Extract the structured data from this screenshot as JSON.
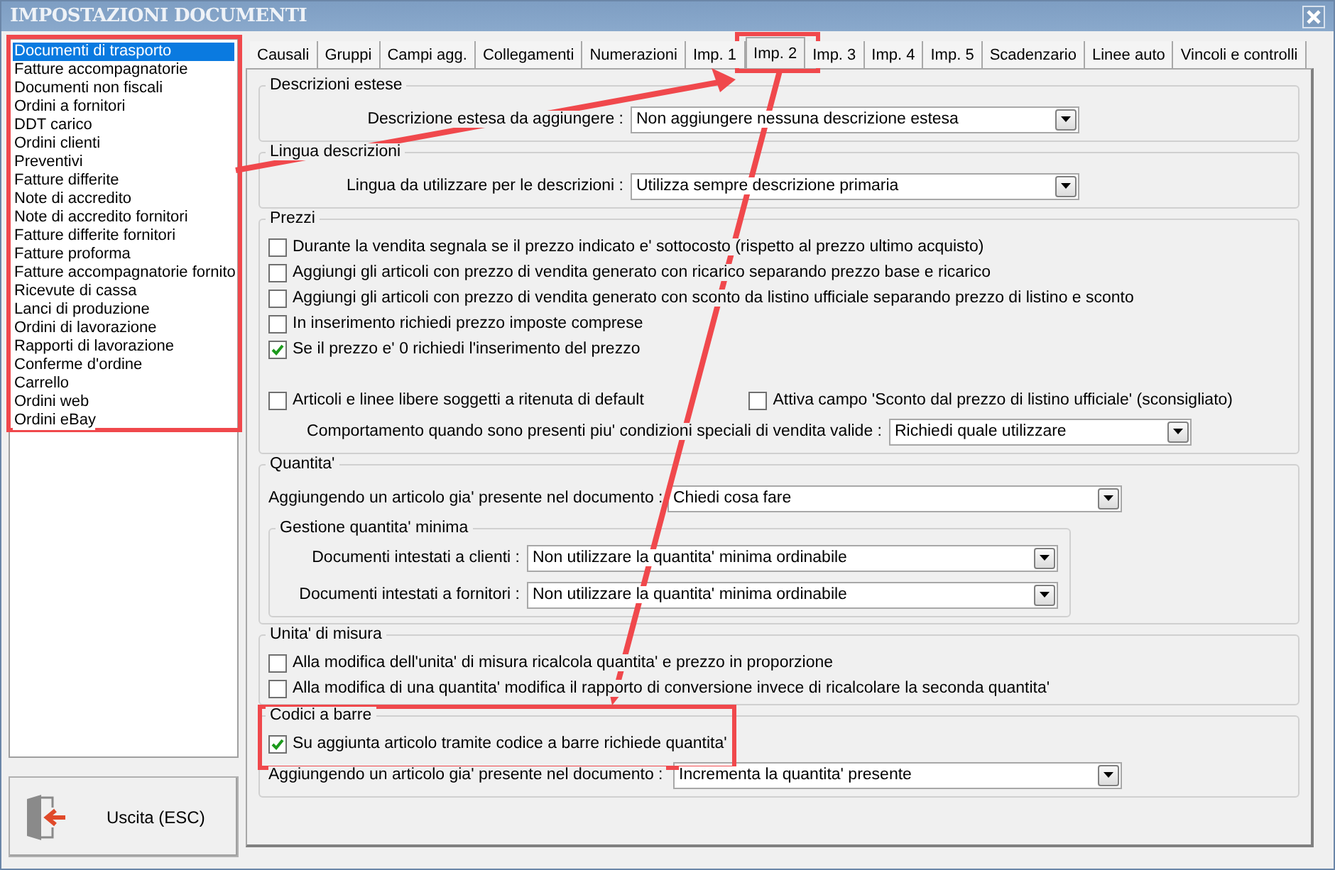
{
  "window": {
    "title": "IMPOSTAZIONI DOCUMENTI"
  },
  "document_types": [
    {
      "label": "Documenti di trasporto",
      "selected": true
    },
    {
      "label": "Fatture accompagnatorie",
      "selected": false
    },
    {
      "label": "Documenti non fiscali",
      "selected": false
    },
    {
      "label": "Ordini a fornitori",
      "selected": false
    },
    {
      "label": "DDT carico",
      "selected": false
    },
    {
      "label": "Ordini clienti",
      "selected": false
    },
    {
      "label": "Preventivi",
      "selected": false
    },
    {
      "label": "Fatture differite",
      "selected": false
    },
    {
      "label": "Note di accredito",
      "selected": false
    },
    {
      "label": "Note di accredito fornitori",
      "selected": false
    },
    {
      "label": "Fatture differite fornitori",
      "selected": false
    },
    {
      "label": "Fatture proforma",
      "selected": false
    },
    {
      "label": "Fatture accompagnatorie fornito",
      "selected": false
    },
    {
      "label": "Ricevute di cassa",
      "selected": false
    },
    {
      "label": "Lanci di produzione",
      "selected": false
    },
    {
      "label": "Ordini di lavorazione",
      "selected": false
    },
    {
      "label": "Rapporti di lavorazione",
      "selected": false
    },
    {
      "label": "Conferme d'ordine",
      "selected": false
    },
    {
      "label": "Carrello",
      "selected": false
    },
    {
      "label": "Ordini web",
      "selected": false
    },
    {
      "label": "Ordini eBay",
      "selected": false
    }
  ],
  "exit_button": {
    "label": "Uscita (ESC)"
  },
  "tabs": [
    {
      "label": "Causali",
      "selected": false
    },
    {
      "label": "Gruppi",
      "selected": false
    },
    {
      "label": "Campi agg.",
      "selected": false
    },
    {
      "label": "Collegamenti",
      "selected": false
    },
    {
      "label": "Numerazioni",
      "selected": false
    },
    {
      "label": "Imp. 1",
      "selected": false
    },
    {
      "label": "Imp. 2",
      "selected": true
    },
    {
      "label": "Imp. 3",
      "selected": false
    },
    {
      "label": "Imp. 4",
      "selected": false
    },
    {
      "label": "Imp. 5",
      "selected": false
    },
    {
      "label": "Scadenzario",
      "selected": false
    },
    {
      "label": "Linee auto",
      "selected": false
    },
    {
      "label": "Vincoli e controlli",
      "selected": false
    }
  ],
  "groups": [
    {
      "title": "Descrizioni estese",
      "rows": [
        {
          "kind": "select",
          "label": "Descrizione estesa da aggiungere :",
          "value": "Non aggiungere nessuna descrizione estesa"
        }
      ]
    },
    {
      "title": "Lingua descrizioni",
      "rows": [
        {
          "kind": "select",
          "label": "Lingua da utilizzare per le descrizioni :",
          "value": "Utilizza sempre descrizione primaria"
        }
      ]
    },
    {
      "title": "Prezzi",
      "rows": [
        {
          "kind": "checkbox",
          "label": "Durante la vendita segnala se il prezzo indicato e' sottocosto (rispetto al prezzo ultimo acquisto)",
          "checked": false
        },
        {
          "kind": "checkbox",
          "label": "Aggiungi gli articoli con prezzo di vendita generato con ricarico separando prezzo base e ricarico",
          "checked": false
        },
        {
          "kind": "checkbox",
          "label": "Aggiungi gli articoli con prezzo di vendita generato con sconto da listino ufficiale separando prezzo di listino e sconto",
          "checked": false
        },
        {
          "kind": "checkbox",
          "label": "In inserimento richiedi prezzo imposte comprese",
          "checked": false
        },
        {
          "kind": "checkbox",
          "label": "Se il prezzo e' 0 richiedi l'inserimento del prezzo",
          "checked": true
        },
        {
          "kind": "checkbox_pair",
          "items": [
            {
              "label": "Articoli e linee libere soggetti a ritenuta di default",
              "checked": false
            },
            {
              "label": "Attiva campo 'Sconto dal prezzo di listino ufficiale' (sconsigliato)",
              "checked": false
            }
          ]
        },
        {
          "kind": "select",
          "label": "Comportamento quando sono presenti piu' condizioni speciali di vendita valide :",
          "value": "Richiedi quale utilizzare"
        }
      ]
    },
    {
      "title": "Quantita'",
      "rows": [
        {
          "kind": "select",
          "label": "Aggiungendo un articolo gia' presente nel documento :",
          "value": "Chiedi cosa fare"
        },
        {
          "kind": "subgroup",
          "title": "Gestione quantita' minima",
          "rows": [
            {
              "kind": "select",
              "label": "Documenti intestati a clienti :",
              "value": "Non utilizzare la quantita' minima ordinabile"
            },
            {
              "kind": "select",
              "label": "Documenti intestati a fornitori :",
              "value": "Non utilizzare la quantita' minima ordinabile"
            }
          ]
        }
      ]
    },
    {
      "title": "Unita' di misura",
      "rows": [
        {
          "kind": "checkbox",
          "label": "Alla modifica dell'unita' di misura ricalcola quantita' e prezzo in proporzione",
          "checked": false
        },
        {
          "kind": "checkbox",
          "label": "Alla modifica di una quantita' modifica il rapporto di conversione invece di ricalcolare la seconda quantita'",
          "checked": false
        }
      ]
    },
    {
      "title": "Codici a barre",
      "rows": [
        {
          "kind": "checkbox",
          "label": "Su aggiunta articolo tramite codice a barre richiede quantita'",
          "checked": true
        },
        {
          "kind": "select",
          "label": "Aggiungendo un articolo gia' presente nel documento :",
          "value": "Incrementa la quantita' presente"
        }
      ]
    }
  ]
}
